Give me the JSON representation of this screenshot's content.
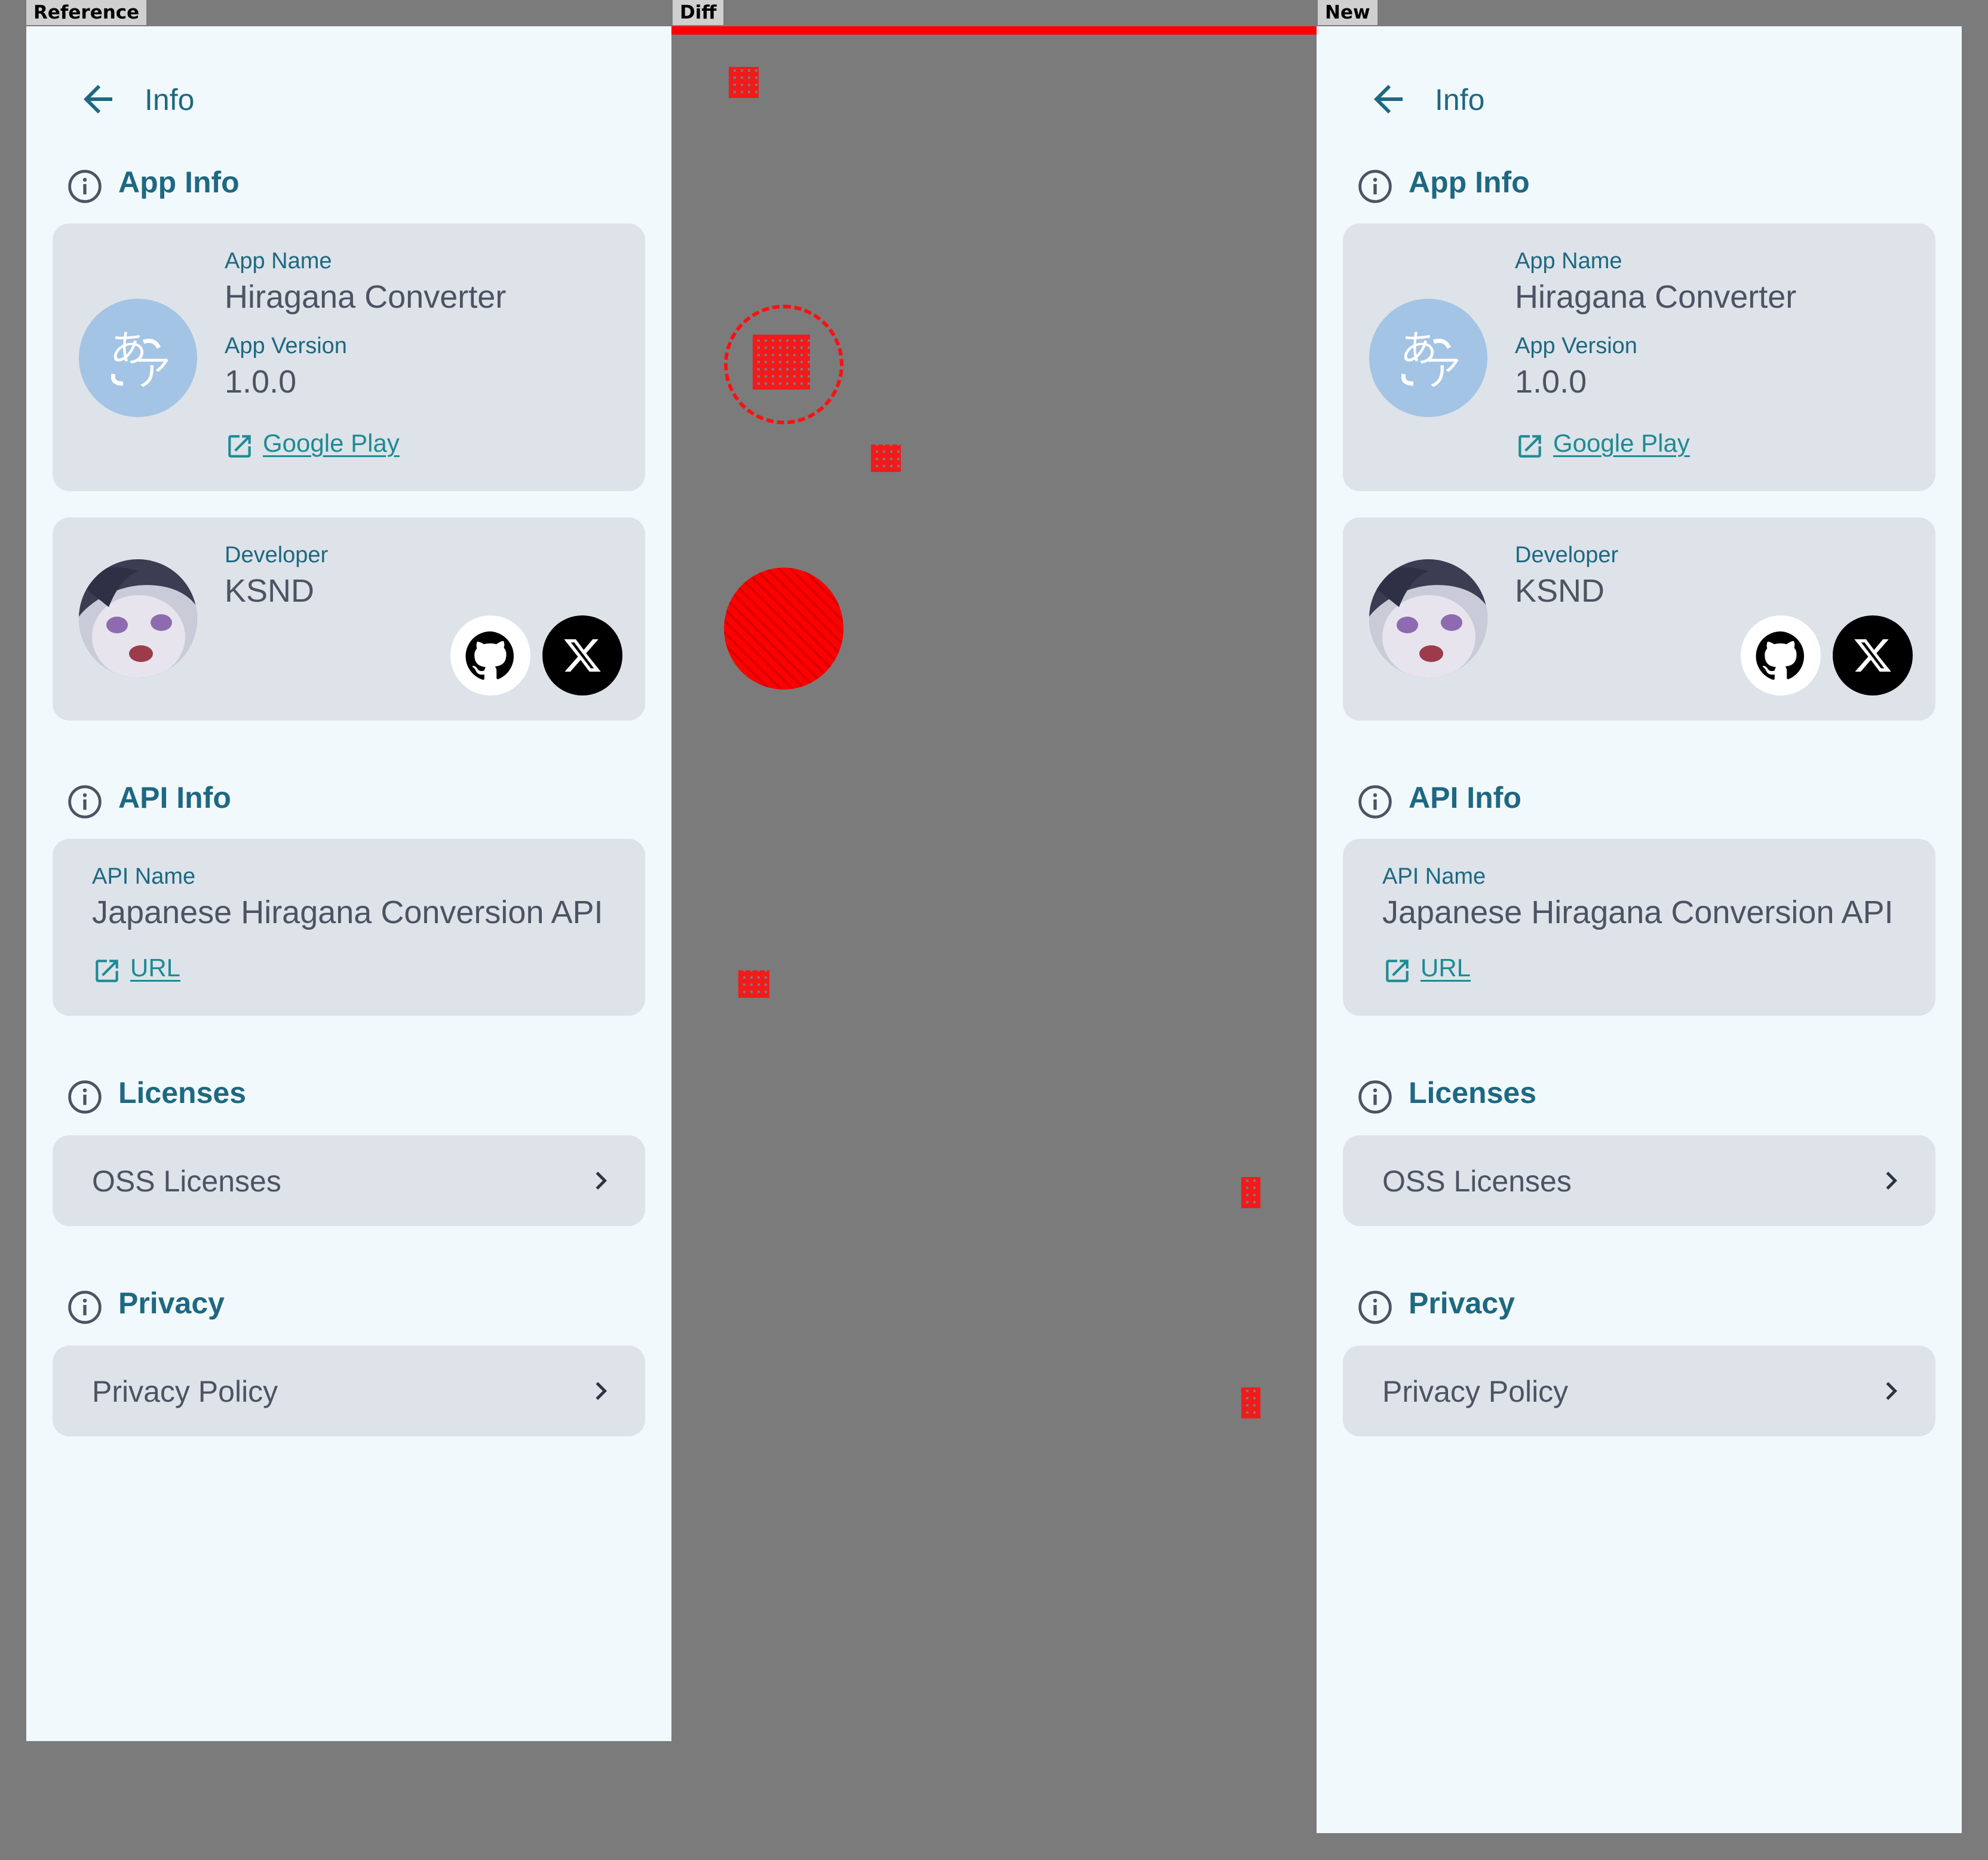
{
  "labels": {
    "reference": "Reference",
    "diff": "Diff",
    "new": "New"
  },
  "screen": {
    "title": "Info",
    "sections": {
      "app_info": "App Info",
      "api_info": "API Info",
      "licenses": "Licenses",
      "privacy": "Privacy"
    },
    "app_card": {
      "name_label": "App Name",
      "name_value": "Hiragana Converter",
      "version_label": "App Version",
      "version_value": "1.0.0",
      "store_link": "Google Play",
      "icon_glyph": "あア"
    },
    "developer_card": {
      "label": "Developer",
      "value": "KSND"
    },
    "api_card": {
      "label": "API Name",
      "value": "Japanese Hiragana Conversion API",
      "link": "URL"
    },
    "oss_licenses": "OSS Licenses",
    "privacy_policy": "Privacy Policy"
  },
  "icons": [
    "back-arrow-icon",
    "info-icon",
    "external-link-icon",
    "github-icon",
    "x-icon",
    "chevron-right-icon"
  ],
  "colors": {
    "accent": "#1e6882",
    "link": "#1f8a93",
    "card": "#dde3e9",
    "background": "#f2f9fc",
    "diff": "#ff0000"
  }
}
